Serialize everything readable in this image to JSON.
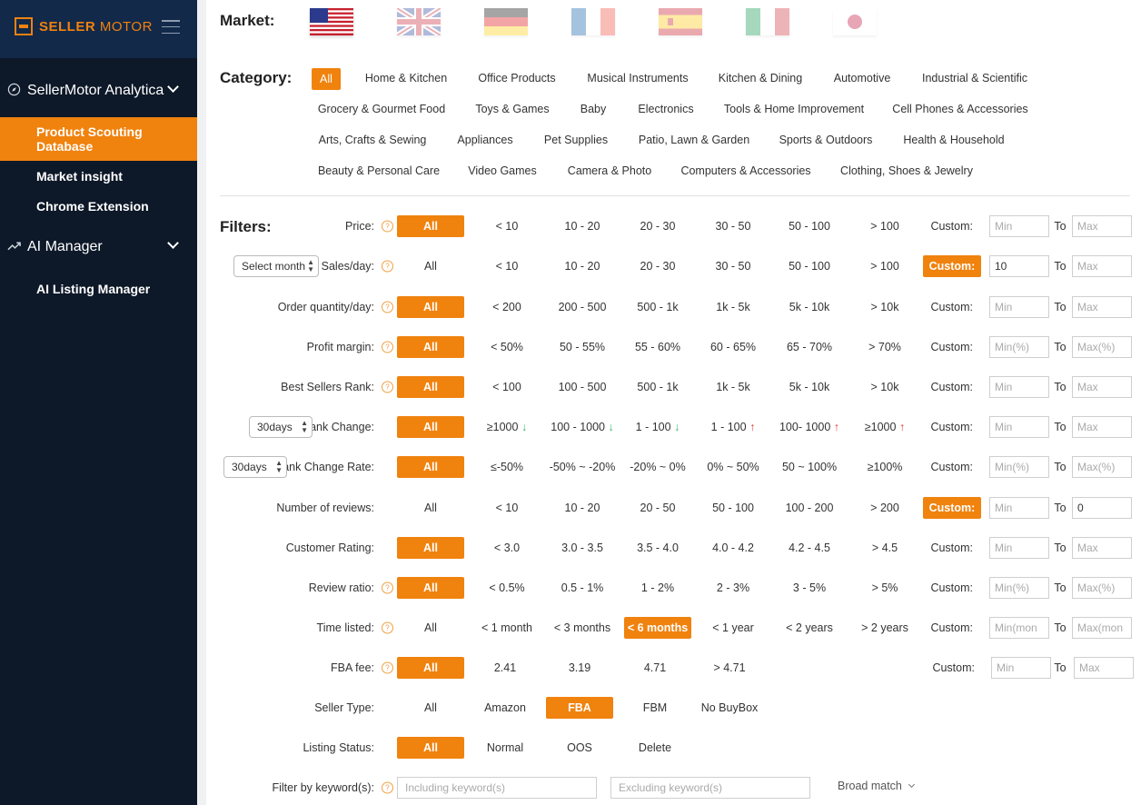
{
  "sidebar": {
    "logo_primary": "SELLER",
    "logo_secondary": "MOTOR",
    "sections": [
      {
        "label": "SellerMotor Analytica"
      },
      {
        "label": "AI Manager"
      }
    ],
    "items": [
      {
        "label": "Product Scouting Database"
      },
      {
        "label": "Market insight"
      },
      {
        "label": "Chrome Extension"
      },
      {
        "label": "AI Listing Manager"
      }
    ]
  },
  "market": {
    "title": "Market:",
    "flags": [
      "us-flag",
      "uk-flag",
      "de-flag",
      "fr-flag",
      "es-flag",
      "it-flag",
      "jp-flag"
    ]
  },
  "category": {
    "title": "Category:",
    "rows": [
      [
        "All",
        "Home & Kitchen",
        "Office Products",
        "Musical Instruments",
        "Kitchen & Dining",
        "Automotive",
        "Industrial & Scientific"
      ],
      [
        "Grocery & Gourmet Food",
        "Toys & Games",
        "Baby",
        "Electronics",
        "Tools & Home Improvement",
        "Cell Phones & Accessories"
      ],
      [
        "Arts, Crafts & Sewing",
        "Appliances",
        "Pet Supplies",
        "Patio, Lawn & Garden",
        "Sports & Outdoors",
        "Health & Household"
      ],
      [
        "Beauty & Personal Care",
        "Video Games",
        "Camera & Photo",
        "Computers & Accessories",
        "Clothing, Shoes & Jewelry"
      ]
    ]
  },
  "filters": {
    "title": "Filters:",
    "custom_label": "Custom:",
    "to_label": "To",
    "rows": [
      {
        "label": "Price:",
        "options": [
          "All",
          "< 10",
          "10 - 20",
          "20 - 30",
          "30 - 50",
          "50 - 100",
          "> 100"
        ],
        "min": "Min",
        "max": "Max",
        "min_val": "",
        "max_val": ""
      },
      {
        "label": "Sales/day:",
        "select": "Select month",
        "options": [
          "All",
          "< 10",
          "10 - 20",
          "20 - 30",
          "30 - 50",
          "50 - 100",
          "> 100"
        ],
        "min": "",
        "max": "Max",
        "min_val": "10",
        "max_val": ""
      },
      {
        "label": "Order quantity/day:",
        "options": [
          "All",
          "< 200",
          "200 - 500",
          "500 - 1k",
          "1k - 5k",
          "5k - 10k",
          "> 10k"
        ],
        "min": "Min",
        "max": "Max",
        "min_val": "",
        "max_val": ""
      },
      {
        "label": "Profit margin:",
        "options": [
          "All",
          "< 50%",
          "50 - 55%",
          "55 - 60%",
          "60 - 65%",
          "65 - 70%",
          "> 70%"
        ],
        "min": "Min(%)",
        "max": "Max(%)",
        "min_val": "",
        "max_val": ""
      },
      {
        "label": "Best Sellers Rank:",
        "options": [
          "All",
          "< 100",
          "100 - 500",
          "500 - 1k",
          "1k - 5k",
          "5k - 10k",
          "> 10k"
        ],
        "min": "Min",
        "max": "Max",
        "min_val": "",
        "max_val": ""
      },
      {
        "label": "Rank Change:",
        "select": "30days",
        "options": [
          "All",
          "≥1000",
          "100 - 1000",
          "1 - 100",
          "1 - 100",
          "100- 1000",
          "≥1000"
        ],
        "min": "Min",
        "max": "Max",
        "min_val": "",
        "max_val": ""
      },
      {
        "label": "Rank Change Rate:",
        "select": "30days",
        "options": [
          "All",
          "≤-50%",
          "-50% ~ -20%",
          "-20% ~ 0%",
          "0% ~ 50%",
          "50 ~ 100%",
          "≥100%"
        ],
        "min": "Min(%)",
        "max": "Max(%)",
        "min_val": "",
        "max_val": ""
      },
      {
        "label": "Number of reviews:",
        "options": [
          "All",
          "< 10",
          "10 - 20",
          "20 - 50",
          "50 - 100",
          "100 - 200",
          "> 200"
        ],
        "min": "Min",
        "max": "",
        "min_val": "",
        "max_val": "0"
      },
      {
        "label": "Customer Rating:",
        "options": [
          "All",
          "< 3.0",
          "3.0 - 3.5",
          "3.5 - 4.0",
          "4.0 - 4.2",
          "4.2 - 4.5",
          "> 4.5"
        ],
        "min": "Min",
        "max": "Max",
        "min_val": "",
        "max_val": ""
      },
      {
        "label": "Review ratio:",
        "options": [
          "All",
          "< 0.5%",
          "0.5 - 1%",
          "1 - 2%",
          "2 - 3%",
          "3 - 5%",
          "> 5%"
        ],
        "min": "Min(%)",
        "max": "Max(%)",
        "min_val": "",
        "max_val": ""
      },
      {
        "label": "Time listed:",
        "options": [
          "All",
          "< 1 month",
          "< 3 months",
          "< 6 months",
          "< 1 year",
          "< 2 years",
          "> 2 years"
        ],
        "min": "Min(mon",
        "max": "Max(mon",
        "min_val": "",
        "max_val": ""
      },
      {
        "label": "FBA fee:",
        "options": [
          "All",
          "2.41",
          "3.19",
          "4.71",
          "> 4.71"
        ],
        "min": "Min",
        "max": "Max",
        "min_val": "",
        "max_val": ""
      },
      {
        "label": "Seller Type:",
        "options": [
          "All",
          "Amazon",
          "FBA",
          "FBM",
          "No BuyBox"
        ]
      },
      {
        "label": "Listing Status:",
        "options": [
          "All",
          "Normal",
          "OOS",
          "Delete"
        ]
      }
    ],
    "keyword": {
      "label": "Filter by keyword(s):",
      "including_placeholder": "Including keyword(s)",
      "excluding_placeholder": "Excluding keyword(s)",
      "match": "Broad match"
    }
  },
  "colors": {
    "accent": "#f0820e",
    "sidebar_bg": "#0d1828",
    "header_bg": "#12294a",
    "down": "#3cb371",
    "up": "#e63c3c"
  }
}
